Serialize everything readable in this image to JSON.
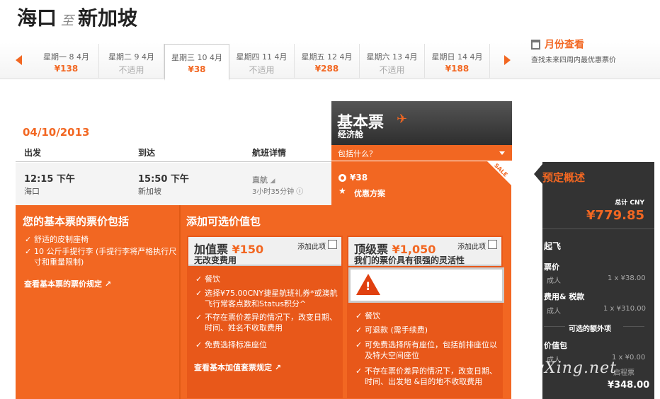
{
  "route": {
    "from": "海口",
    "to_word": "至",
    "to": "新加坡"
  },
  "dates": [
    {
      "label": "星期一 8 4月",
      "price": "¥138"
    },
    {
      "label": "星期二 9 4月",
      "price": "不适用"
    },
    {
      "label": "星期三 10 4月",
      "price": "¥38"
    },
    {
      "label": "星期四 11 4月",
      "price": "不适用"
    },
    {
      "label": "星期五 12 4月",
      "price": "¥288"
    },
    {
      "label": "星期六 13 4月",
      "price": "不适用"
    },
    {
      "label": "星期日 14 4月",
      "price": "¥188"
    }
  ],
  "month_view": {
    "title": "月份查看",
    "subtitle": "查找未来四周内最优惠票价"
  },
  "flight": {
    "date": "04/10/2013",
    "headers": [
      "出发",
      "到达",
      "航班详情"
    ],
    "depart_time": "12:15 下午",
    "depart_city": "海口",
    "arrive_time": "15:50 下午",
    "arrive_city": "新加坡",
    "type": "直航",
    "duration": "3小时35分钟"
  },
  "fare": {
    "name": "基本票",
    "cabin": "经济舱",
    "includes": "包括什么？",
    "price": "¥38",
    "promo": "优惠方案",
    "badge": "SALE"
  },
  "included": {
    "title": "您的基本票的票价包括",
    "items": [
      "舒适的皮制座椅",
      "10 公斤手提行李 (手提行李将严格执行尺寸和重量限制)"
    ],
    "link": "查看基本票的票价规定 ↗"
  },
  "addons": {
    "title": "添加可选价值包",
    "plus": {
      "name": "加值票",
      "price": "¥150",
      "sub": "无改变费用",
      "add": "添加此项",
      "items": [
        "餐饮",
        "选择¥75.00CNY捷星航班礼券*或澳航飞行常客点数和Status积分^",
        "不存在票价差异的情况下，改变日期、时间、姓名不收取费用",
        "免费选择标准座位"
      ],
      "link": "查看基本加值套票规定 ↗"
    },
    "max": {
      "name": "顶级票",
      "price": "¥1,050",
      "sub": "我们的票价具有很强的灵活性",
      "add": "添加此项",
      "items": [
        "餐饮",
        "可退款 (需手续费)",
        "可免费选择所有座位，包括前排座位以及特大空间座位",
        "不存在票价差异的情况下，改变日期、时间、出发地 &目的地不收取费用"
      ]
    }
  },
  "summary": {
    "title": "预定概述",
    "total_label": "总计 CNY",
    "total": "¥779.85",
    "depart": "起飞",
    "fare_label": "票价",
    "adult": "成人",
    "fare_val": "1 x ¥38.00",
    "tax_label": "费用& 税款",
    "tax_val": "1 x ¥310.00",
    "extras": "可选的额外项",
    "pack_label": "价值包",
    "pack_val": "1 x ¥0.00",
    "pack_name": "启程票",
    "sub_total": "¥348.00"
  },
  "watermark": "eLvXing.net"
}
